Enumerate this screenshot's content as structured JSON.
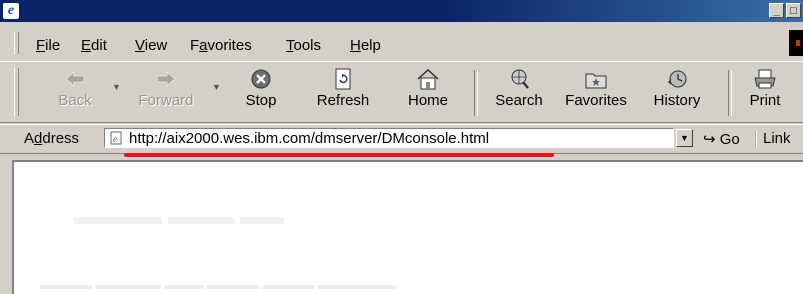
{
  "window": {
    "title": "",
    "controls": [
      "minimize",
      "maximize"
    ]
  },
  "menubar": {
    "items": [
      {
        "key": "file",
        "mnemonic": "F",
        "rest": "ile"
      },
      {
        "key": "edit",
        "mnemonic": "E",
        "rest": "dit"
      },
      {
        "key": "view",
        "mnemonic": "V",
        "rest": "iew"
      },
      {
        "key": "favorites",
        "pre": "F",
        "mnemonic": "a",
        "rest": "vorites"
      },
      {
        "key": "tools",
        "mnemonic": "T",
        "rest": "ools"
      },
      {
        "key": "help",
        "mnemonic": "H",
        "rest": "elp"
      }
    ]
  },
  "toolbar": {
    "back": "Back",
    "forward": "Forward",
    "stop": "Stop",
    "refresh": "Refresh",
    "home": "Home",
    "search": "Search",
    "favorites": "Favorites",
    "history": "History",
    "print": "Print"
  },
  "addressbar": {
    "label_mnemonic": "d",
    "label_pre": "A",
    "label_rest": "dress",
    "url": "http://aix2000.wes.ibm.com/dmserver/DMconsole.html",
    "go": "Go",
    "links": "Link"
  },
  "colors": {
    "titlebar": "#0a246a",
    "underline": "#e8141e",
    "chrome": "#d4d0c8"
  }
}
